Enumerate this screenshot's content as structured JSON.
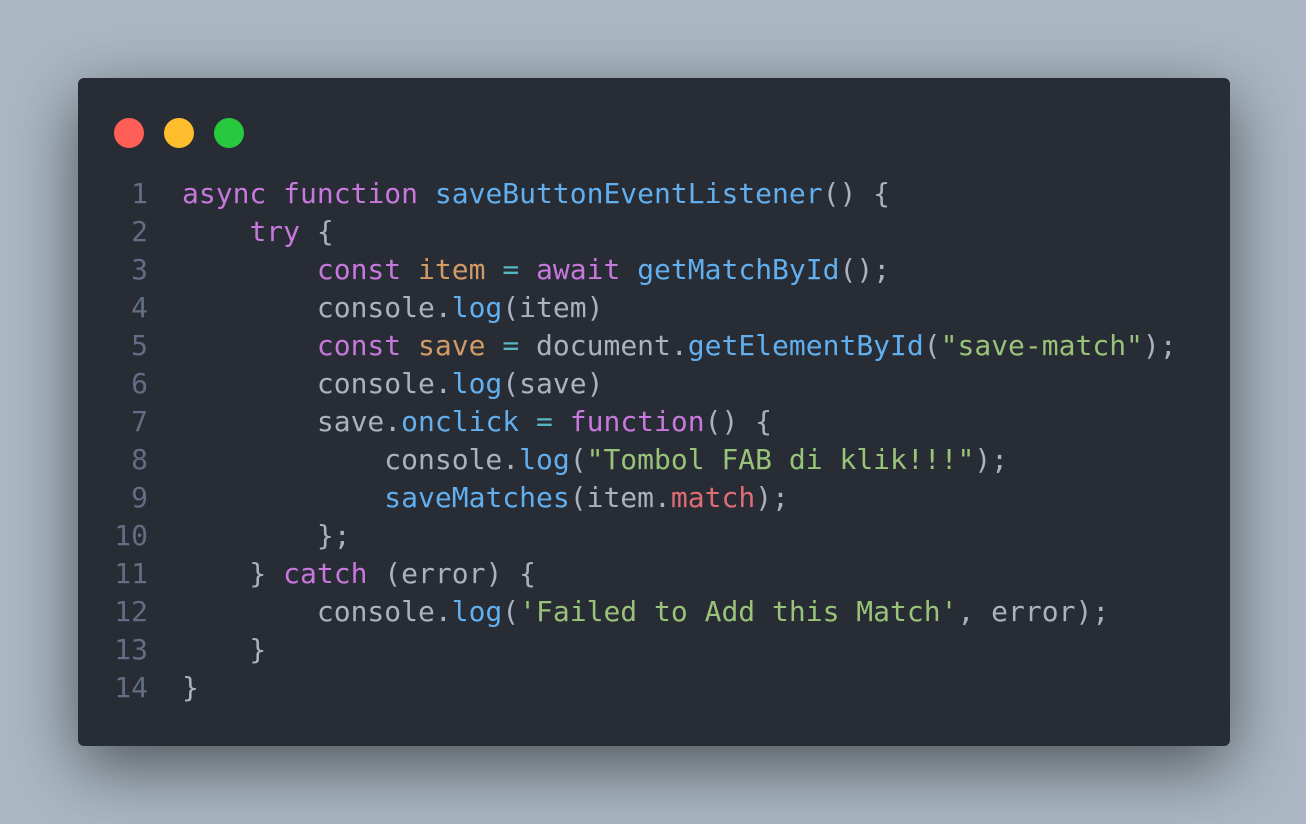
{
  "window": {
    "colors": {
      "background": "#abb8c3",
      "editor": "#282c34",
      "close": "#ff5f56",
      "minimize": "#ffbd2e",
      "zoom": "#27c93f"
    }
  },
  "code": {
    "lines": [
      {
        "num": "1",
        "tokens": [
          {
            "t": "async",
            "c": "keyword"
          },
          {
            "t": " ",
            "c": "plain"
          },
          {
            "t": "function",
            "c": "keyword"
          },
          {
            "t": " ",
            "c": "plain"
          },
          {
            "t": "saveButtonEventListener",
            "c": "fn"
          },
          {
            "t": "() {",
            "c": "plain"
          }
        ]
      },
      {
        "num": "2",
        "tokens": [
          {
            "t": "    ",
            "c": "plain"
          },
          {
            "t": "try",
            "c": "keyword"
          },
          {
            "t": " {",
            "c": "plain"
          }
        ]
      },
      {
        "num": "3",
        "tokens": [
          {
            "t": "        ",
            "c": "plain"
          },
          {
            "t": "const",
            "c": "keyword"
          },
          {
            "t": " ",
            "c": "plain"
          },
          {
            "t": "item",
            "c": "var"
          },
          {
            "t": " ",
            "c": "plain"
          },
          {
            "t": "=",
            "c": "op"
          },
          {
            "t": " ",
            "c": "plain"
          },
          {
            "t": "await",
            "c": "keyword"
          },
          {
            "t": " ",
            "c": "plain"
          },
          {
            "t": "getMatchById",
            "c": "fn"
          },
          {
            "t": "();",
            "c": "plain"
          }
        ]
      },
      {
        "num": "4",
        "tokens": [
          {
            "t": "        console.",
            "c": "plain"
          },
          {
            "t": "log",
            "c": "fn"
          },
          {
            "t": "(item)",
            "c": "plain"
          }
        ]
      },
      {
        "num": "5",
        "tokens": [
          {
            "t": "        ",
            "c": "plain"
          },
          {
            "t": "const",
            "c": "keyword"
          },
          {
            "t": " ",
            "c": "plain"
          },
          {
            "t": "save",
            "c": "var"
          },
          {
            "t": " ",
            "c": "plain"
          },
          {
            "t": "=",
            "c": "op"
          },
          {
            "t": " document.",
            "c": "plain"
          },
          {
            "t": "getElementById",
            "c": "fn"
          },
          {
            "t": "(",
            "c": "plain"
          },
          {
            "t": "\"save-match\"",
            "c": "str"
          },
          {
            "t": ");",
            "c": "plain"
          }
        ]
      },
      {
        "num": "6",
        "tokens": [
          {
            "t": "        console.",
            "c": "plain"
          },
          {
            "t": "log",
            "c": "fn"
          },
          {
            "t": "(save)",
            "c": "plain"
          }
        ]
      },
      {
        "num": "7",
        "tokens": [
          {
            "t": "        save.",
            "c": "plain"
          },
          {
            "t": "onclick",
            "c": "fn"
          },
          {
            "t": " ",
            "c": "plain"
          },
          {
            "t": "=",
            "c": "op"
          },
          {
            "t": " ",
            "c": "plain"
          },
          {
            "t": "function",
            "c": "keyword"
          },
          {
            "t": "() {",
            "c": "plain"
          }
        ]
      },
      {
        "num": "8",
        "tokens": [
          {
            "t": "            console.",
            "c": "plain"
          },
          {
            "t": "log",
            "c": "fn"
          },
          {
            "t": "(",
            "c": "plain"
          },
          {
            "t": "\"Tombol FAB di klik!!!\"",
            "c": "str"
          },
          {
            "t": ");",
            "c": "plain"
          }
        ]
      },
      {
        "num": "9",
        "tokens": [
          {
            "t": "            ",
            "c": "plain"
          },
          {
            "t": "saveMatches",
            "c": "fn"
          },
          {
            "t": "(item.",
            "c": "plain"
          },
          {
            "t": "match",
            "c": "prop"
          },
          {
            "t": ");",
            "c": "plain"
          }
        ]
      },
      {
        "num": "10",
        "tokens": [
          {
            "t": "        };",
            "c": "plain"
          }
        ]
      },
      {
        "num": "11",
        "tokens": [
          {
            "t": "    } ",
            "c": "plain"
          },
          {
            "t": "catch",
            "c": "keyword"
          },
          {
            "t": " (error) {",
            "c": "plain"
          }
        ]
      },
      {
        "num": "12",
        "tokens": [
          {
            "t": "        console.",
            "c": "plain"
          },
          {
            "t": "log",
            "c": "fn"
          },
          {
            "t": "(",
            "c": "plain"
          },
          {
            "t": "'Failed to Add this Match'",
            "c": "str"
          },
          {
            "t": ", error);",
            "c": "plain"
          }
        ]
      },
      {
        "num": "13",
        "tokens": [
          {
            "t": "    }",
            "c": "plain"
          }
        ]
      },
      {
        "num": "14",
        "tokens": [
          {
            "t": "}",
            "c": "plain"
          }
        ]
      }
    ]
  }
}
